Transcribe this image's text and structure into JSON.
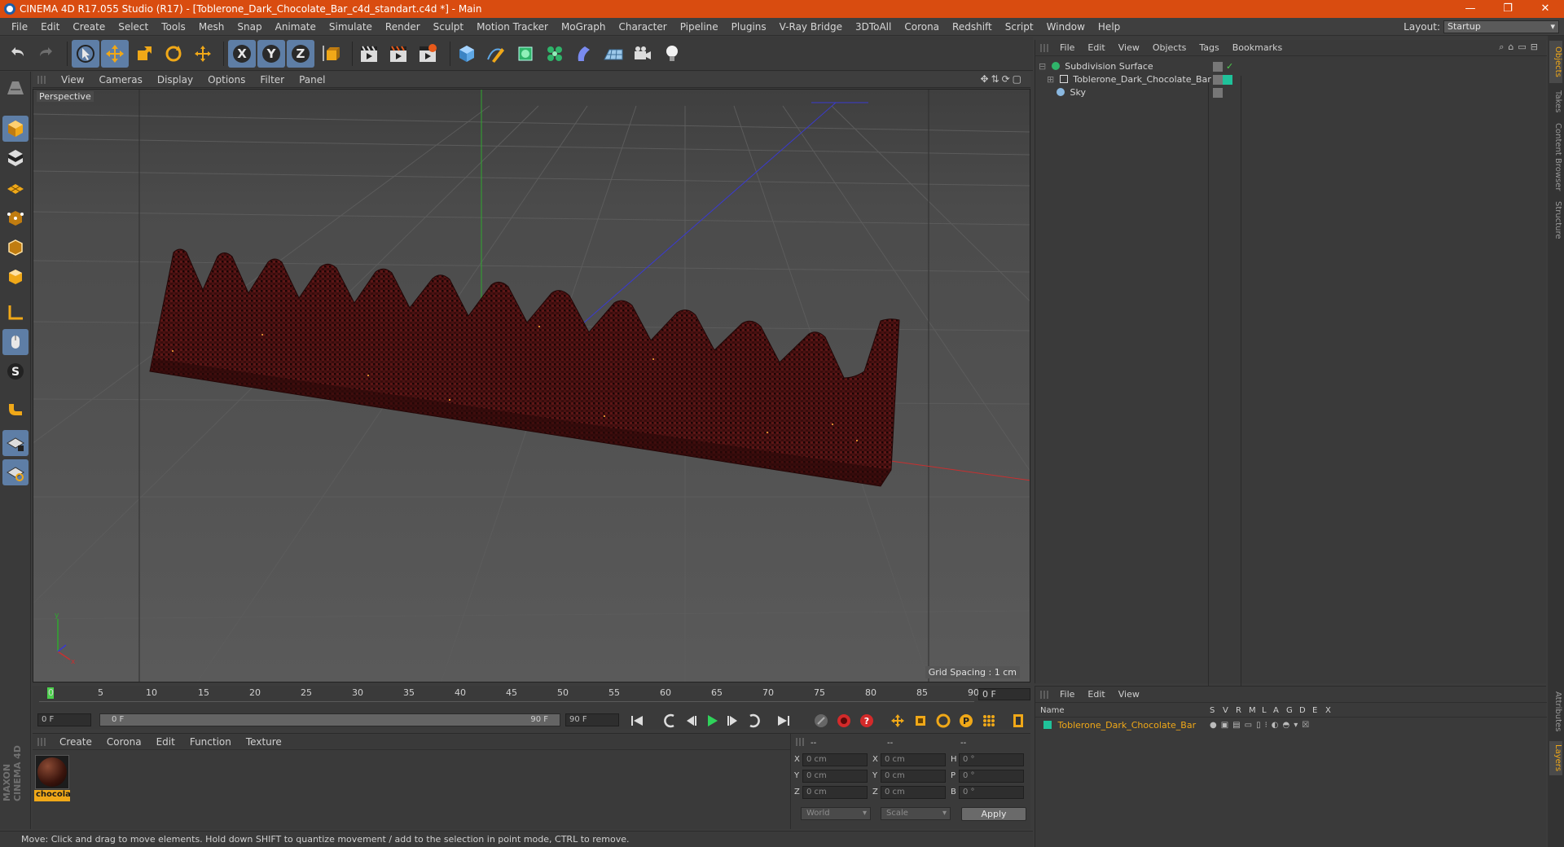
{
  "window": {
    "title": "CINEMA 4D R17.055 Studio (R17) - [Toblerone_Dark_Chocolate_Bar_c4d_standart.c4d *] - Main",
    "minimize": "—",
    "restore": "❐",
    "close": "✕"
  },
  "menubar": {
    "items": [
      "File",
      "Edit",
      "Create",
      "Select",
      "Tools",
      "Mesh",
      "Snap",
      "Animate",
      "Simulate",
      "Render",
      "Sculpt",
      "Motion Tracker",
      "MoGraph",
      "Character",
      "Pipeline",
      "Plugins",
      "V-Ray Bridge",
      "3DToAll",
      "Corona",
      "Redshift",
      "Script",
      "Window",
      "Help"
    ],
    "layout_label": "Layout:",
    "layout_value": "Startup"
  },
  "toolbar": {
    "axis_x": "X",
    "axis_y": "Y",
    "axis_z": "Z"
  },
  "viewport": {
    "menu": [
      "View",
      "Cameras",
      "Display",
      "Options",
      "Filter",
      "Panel"
    ],
    "label": "Perspective",
    "grid_spacing": "Grid Spacing : 1 cm",
    "axis_labels": {
      "x": "x",
      "y": "y"
    }
  },
  "timeline": {
    "ticks": [
      "0",
      "5",
      "10",
      "15",
      "20",
      "25",
      "30",
      "35",
      "40",
      "45",
      "50",
      "55",
      "60",
      "65",
      "70",
      "75",
      "80",
      "85",
      "90"
    ],
    "current_frame": "0 F",
    "start_field": "0 F",
    "range_start": "0 F",
    "range_end": "90 F",
    "end_field": "90 F"
  },
  "material_manager": {
    "menu": [
      "Create",
      "Corona",
      "Edit",
      "Function",
      "Texture"
    ],
    "material_name": "chocola"
  },
  "coordinates": {
    "header": [
      "--",
      "--",
      "--"
    ],
    "rows": [
      {
        "l1": "X",
        "v1": "0 cm",
        "l2": "X",
        "v2": "0 cm",
        "l3": "H",
        "v3": "0 °"
      },
      {
        "l1": "Y",
        "v1": "0 cm",
        "l2": "Y",
        "v2": "0 cm",
        "l3": "P",
        "v3": "0 °"
      },
      {
        "l1": "Z",
        "v1": "0 cm",
        "l2": "Z",
        "v2": "0 cm",
        "l3": "B",
        "v3": "0 °"
      }
    ],
    "mode_world": "World",
    "mode_scale": "Scale",
    "apply": "Apply"
  },
  "object_manager": {
    "menu": [
      "File",
      "Edit",
      "View",
      "Objects",
      "Tags",
      "Bookmarks"
    ],
    "objects": [
      {
        "name": "Subdivision Surface"
      },
      {
        "name": "Toblerone_Dark_Chocolate_Bar"
      },
      {
        "name": "Sky"
      }
    ]
  },
  "layer_manager": {
    "menu": [
      "File",
      "Edit",
      "View"
    ],
    "columns": [
      "Name",
      "S",
      "V",
      "R",
      "M",
      "L",
      "A",
      "G",
      "D",
      "E",
      "X"
    ],
    "layer_name": "Toblerone_Dark_Chocolate_Bar",
    "layer_color": "#1fc29a"
  },
  "side_tabs": [
    "Objects",
    "Takes",
    "Content Browser",
    "Structure"
  ],
  "side_tabs_bottom": [
    "Attributes",
    "Layers"
  ],
  "status": "Move: Click and drag to move elements. Hold down SHIFT to quantize movement / add to the selection in point mode, CTRL to remove.",
  "colors": {
    "accent": "#d94c10",
    "selection": "#5e7ea6",
    "highlight": "#f0a818"
  }
}
